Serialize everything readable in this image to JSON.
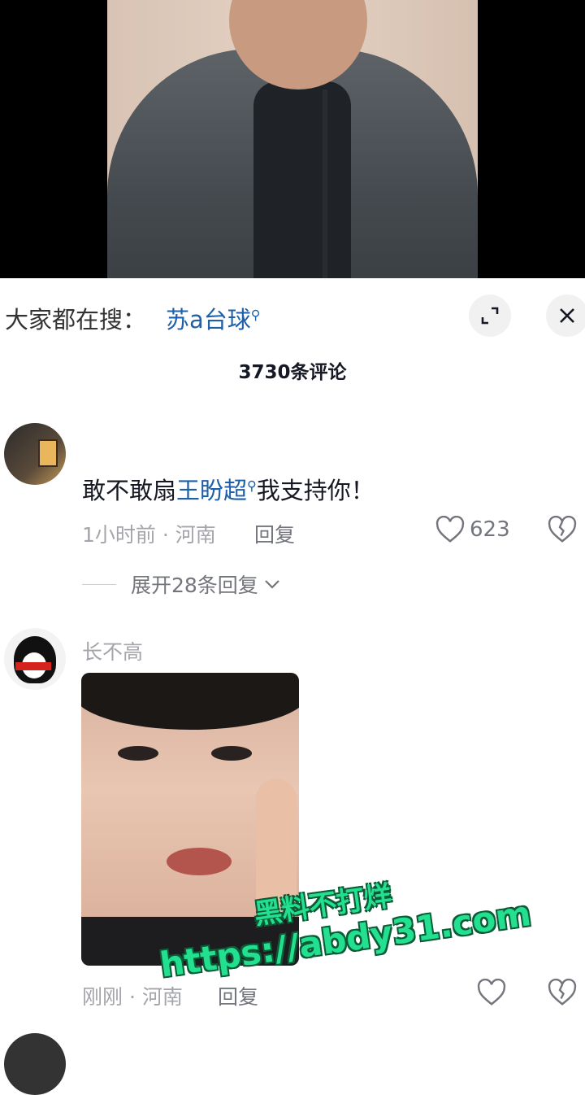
{
  "search": {
    "prefix": "大家都在搜：",
    "term": "苏a台球"
  },
  "comments_header": {
    "count_label": "3730条评论"
  },
  "comments": [
    {
      "username": "",
      "text_before": "敢不敢扇",
      "text_link": "王盼超",
      "text_after": "我支持你！",
      "time_location": "1小时前 · 河南",
      "reply_label": "回复",
      "like_count": "623",
      "expand_label": "展开28条回复"
    },
    {
      "username": "长不高",
      "time_location": "刚刚 · 河南",
      "reply_label": "回复"
    }
  ],
  "watermark": {
    "line1": "黑料不打烊",
    "line2": "https://abdy31.com"
  },
  "colors": {
    "link": "#1d5fa8",
    "muted": "#a4a5aa",
    "watermark": "#22e08f"
  }
}
